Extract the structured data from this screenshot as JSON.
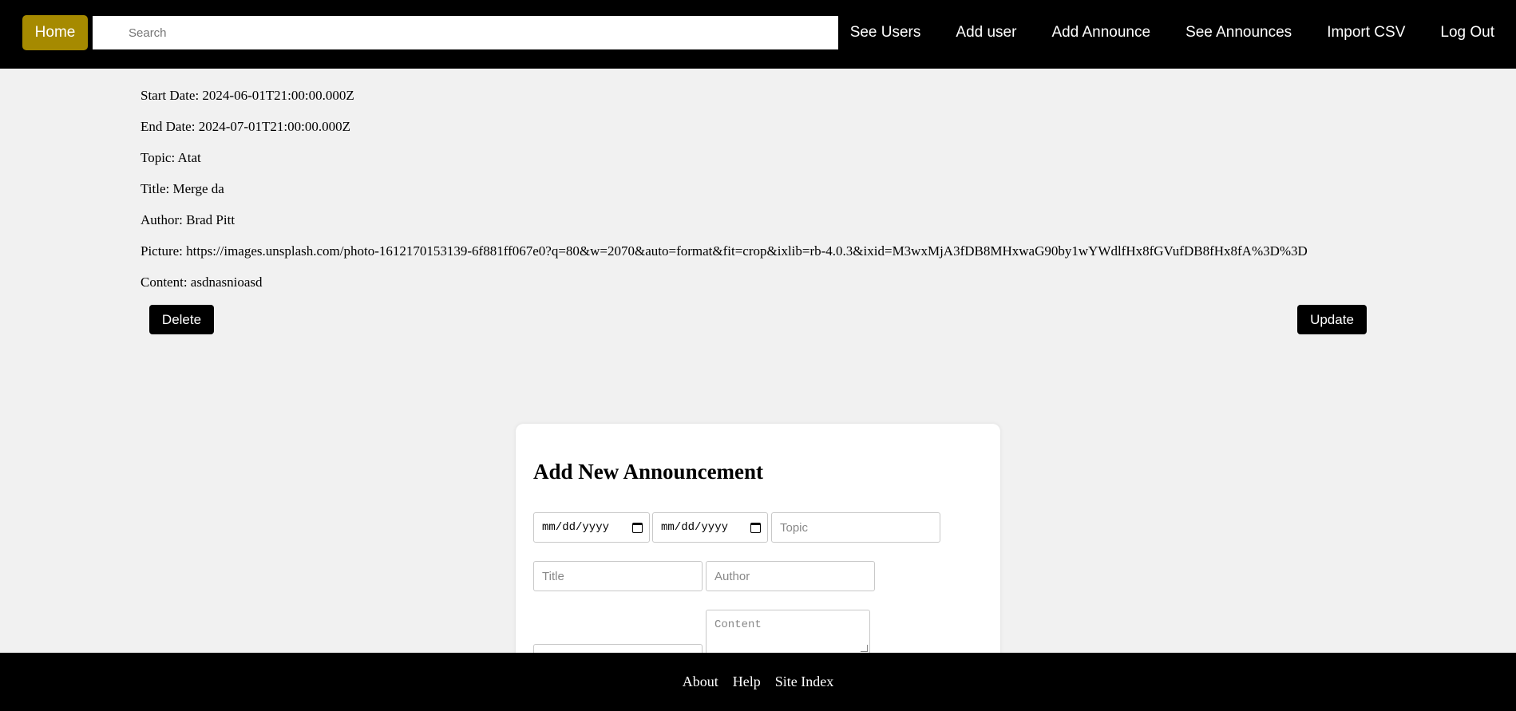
{
  "nav": {
    "home": "Home",
    "search_placeholder": "Search",
    "links": [
      "See Users",
      "Add user",
      "Add Announce",
      "See Announces",
      "Import CSV",
      "Log Out"
    ]
  },
  "announcement": {
    "start_date": "Start Date: 2024-06-01T21:00:00.000Z",
    "end_date": "End Date: 2024-07-01T21:00:00.000Z",
    "topic": "Topic: Atat",
    "title": "Title: Merge da",
    "author": "Author: Brad Pitt",
    "picture": "Picture: https://images.unsplash.com/photo-1612170153139-6f881ff067e0?q=80&w=2070&auto=format&fit=crop&ixlib=rb-4.0.3&ixid=M3wxMjA3fDB8MHxwaG90by1wYWdlfHx8fGVufDB8fHx8fA%3D%3D",
    "content": "Content: asdnasnioasd",
    "delete_label": "Delete",
    "update_label": "Update"
  },
  "form": {
    "heading": "Add New Announcement",
    "start_date_placeholder": "mm/dd/yyyy",
    "end_date_placeholder": "mm/dd/yyyy",
    "topic_placeholder": "Topic",
    "title_placeholder": "Title",
    "author_placeholder": "Author",
    "content_placeholder": "Content"
  },
  "footer": {
    "links": [
      "About",
      "Help",
      "Site Index"
    ]
  },
  "colors": {
    "home_button": "#a68a00",
    "nav_background": "#000000",
    "page_background": "#f1f1f1"
  }
}
